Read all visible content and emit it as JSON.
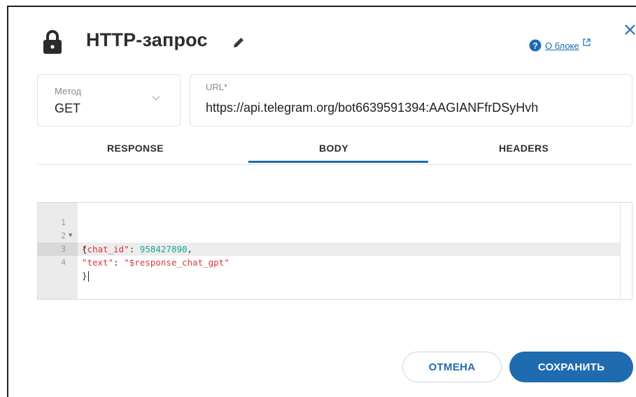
{
  "dialog": {
    "title": "HTTP-запрос",
    "about_link": "О блоке"
  },
  "method": {
    "label": "Метод",
    "value": "GET"
  },
  "url": {
    "label": "URL*",
    "value": "https://api.telegram.org/bot6639591394:AAGIANFfrDSyHvh"
  },
  "tabs": [
    {
      "label": "RESPONSE",
      "active": false
    },
    {
      "label": "BODY",
      "active": true
    },
    {
      "label": "HEADERS",
      "active": false
    }
  ],
  "editor": {
    "lines": [
      {
        "num": "1",
        "text": "{"
      },
      {
        "num": "2",
        "key": "\"chat_id\"",
        "sep": ": ",
        "value": "958427890",
        "end": ","
      },
      {
        "num": "3",
        "key": "\"text\"",
        "sep": ": ",
        "value": "\"$response_chat_gpt\"",
        "end": ""
      },
      {
        "num": "4",
        "text": "}"
      }
    ],
    "active_line": 4
  },
  "buttons": {
    "cancel": "ОТМЕНА",
    "save": "СОХРАНИТЬ"
  },
  "colors": {
    "accent": "#1e6bb0",
    "json_key": "#d43a3a",
    "json_number": "#18a39a"
  },
  "icons": [
    "lock-icon",
    "pencil-icon",
    "help-icon",
    "external-link-icon",
    "close-icon",
    "chevron-down-icon",
    "fold-arrow-icon"
  ]
}
